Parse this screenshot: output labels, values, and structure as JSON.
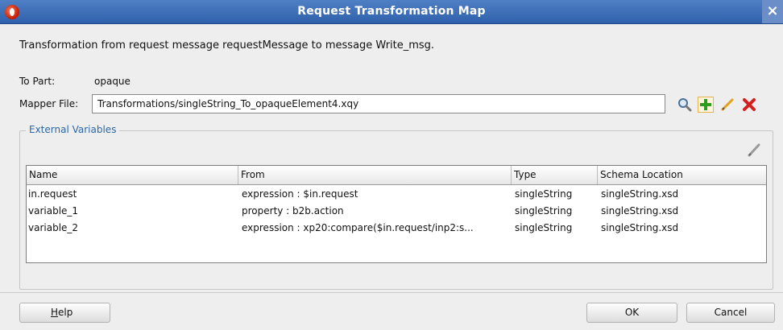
{
  "window": {
    "title": "Request Transformation Map",
    "close_icon": "×"
  },
  "description": "Transformation from request message requestMessage to message Write_msg.",
  "to_part": {
    "label": "To Part:",
    "value": "opaque"
  },
  "mapper_file": {
    "label": "Mapper File:",
    "value": "Transformations/singleString_To_opaqueElement4.xqy",
    "icons": [
      "search-icon",
      "add-icon",
      "edit-icon",
      "delete-icon"
    ]
  },
  "external_variables": {
    "legend": "External Variables",
    "columns": [
      "Name",
      "From",
      "Type",
      "Schema Location"
    ],
    "rows": [
      [
        "in.request",
        "expression : $in.request",
        "singleString",
        "singleString.xsd"
      ],
      [
        "variable_1",
        "property : b2b.action",
        "singleString",
        "singleString.xsd"
      ],
      [
        "variable_2",
        "expression : xp20:compare($in.request/inp2:s...",
        "singleString",
        "singleString.xsd"
      ]
    ]
  },
  "buttons": {
    "help_mnemonic": "H",
    "help_rest": "elp",
    "ok": "OK",
    "cancel": "Cancel"
  },
  "colors": {
    "title_bar": "#3a6fbc",
    "legend_text": "#2c67a5",
    "delete_icon": "#d51f1f",
    "add_icon": "#2f9b21",
    "edit_icon": "#e3a21a"
  }
}
